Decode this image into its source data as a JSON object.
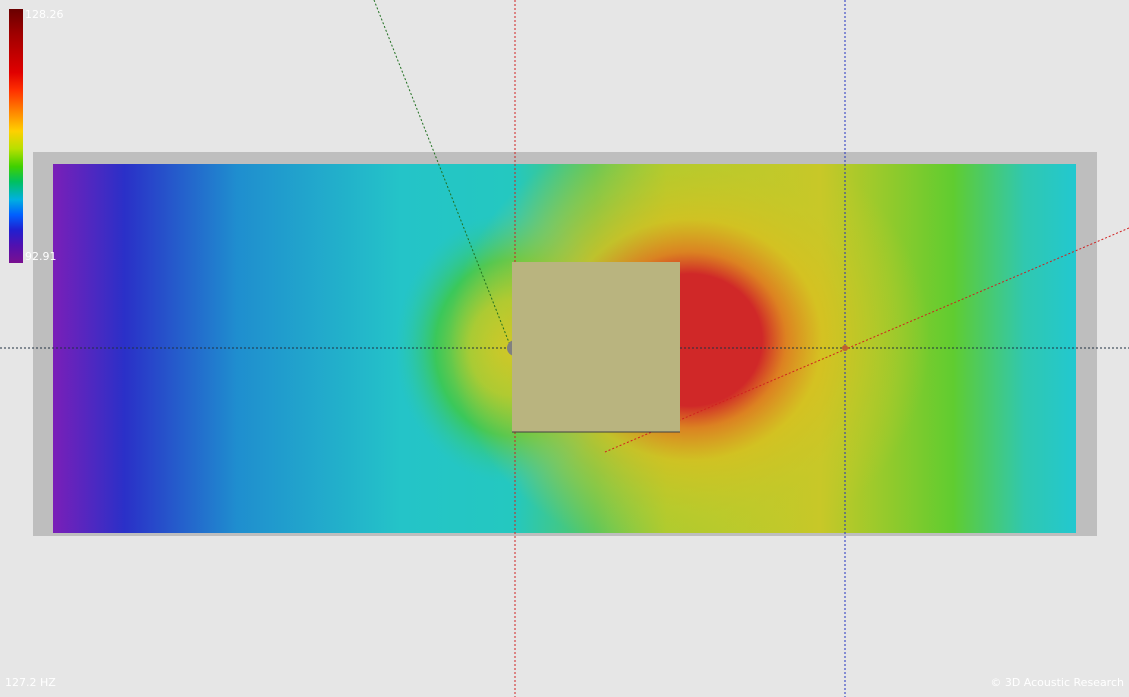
{
  "legend": {
    "max_label": "128.26",
    "min_label": "92.91"
  },
  "status": {
    "frequency": "127.2 HZ",
    "copyright": "© 3D Acoustic Research"
  },
  "colors": {
    "background": "#e6e6e6",
    "room_wall": "#bebebe",
    "obstacle": "#b9b47f",
    "x_axis": "#203040",
    "y_axis_red": "#d02020",
    "y_axis_blue": "#2030c0",
    "listener_marker": "#c06030"
  }
}
